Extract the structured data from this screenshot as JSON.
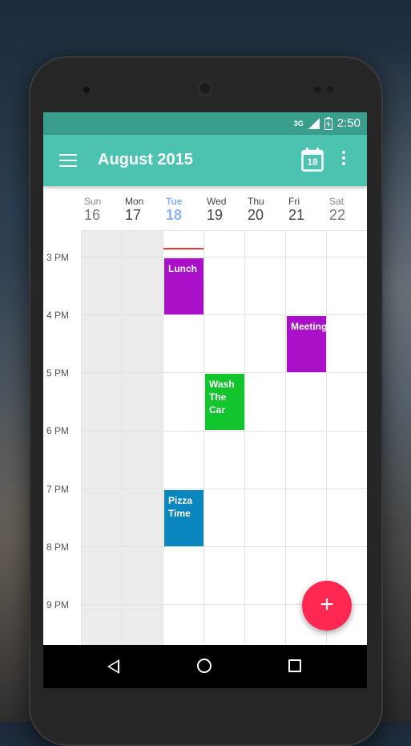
{
  "statusbar": {
    "network": "3G",
    "time": "2:50"
  },
  "appbar": {
    "title": "August 2015",
    "today_day": "18"
  },
  "week": {
    "days": [
      {
        "name": "Sun",
        "date": "16"
      },
      {
        "name": "Mon",
        "date": "17"
      },
      {
        "name": "Tue",
        "date": "18"
      },
      {
        "name": "Wed",
        "date": "19"
      },
      {
        "name": "Thu",
        "date": "20"
      },
      {
        "name": "Fri",
        "date": "21"
      },
      {
        "name": "Sat",
        "date": "22"
      }
    ],
    "hours": [
      "3 PM",
      "4 PM",
      "5 PM",
      "6 PM",
      "7 PM",
      "8 PM",
      "9 PM"
    ]
  },
  "events": [
    {
      "title": "Lunch",
      "color": "#a910c8"
    },
    {
      "title": "Meeting",
      "color": "#a910c8"
    },
    {
      "title": "Wash The Car",
      "color": "#12c52c"
    },
    {
      "title": "Pizza Time",
      "color": "#0a86bf"
    }
  ],
  "fab": {
    "label": "+"
  },
  "colors": {
    "accent": "#4cc2b0",
    "statusbar": "#3a9e8c",
    "now_line": "#e53935"
  }
}
